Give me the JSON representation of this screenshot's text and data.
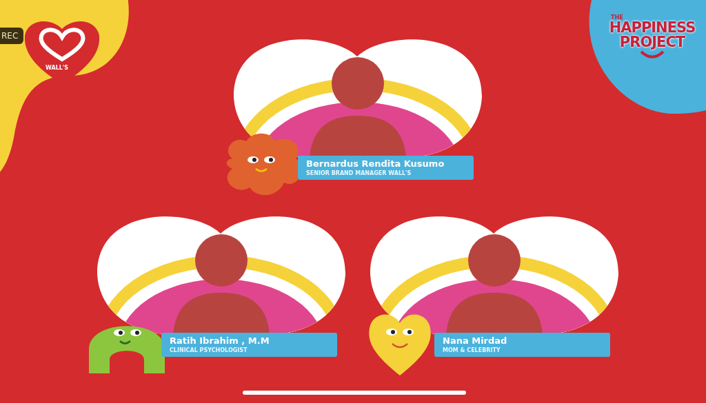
{
  "recording_badge": "REC",
  "brand_logo": {
    "text": "WALL'S"
  },
  "event_logo": {
    "small": "THE",
    "line_1": "HAPPINESS",
    "line_2": "PROJECT"
  },
  "speakers": [
    {
      "name": "Bernardus Rendita Kusumo",
      "role": "SENIOR BRAND MANAGER WALL'S",
      "kind": "flower"
    },
    {
      "name": "Ratih Ibrahim , M.M",
      "role": "CLINICAL PSYCHOLOGIST",
      "kind": "arch"
    },
    {
      "name": "Nana Mirdad",
      "role": "MOM & CELEBRITY",
      "kind": "heart"
    }
  ]
}
